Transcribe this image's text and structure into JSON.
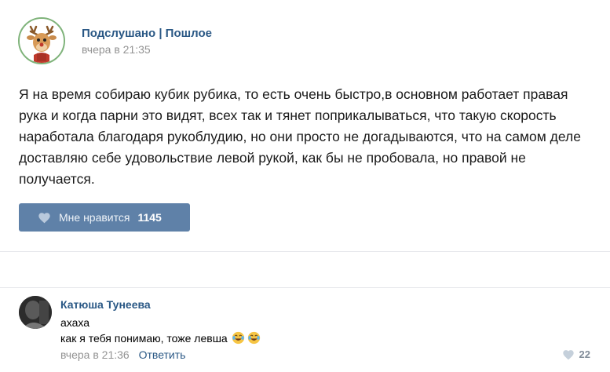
{
  "post": {
    "author": "Подслушано | Пошлое",
    "time": "вчера в 21:35",
    "text": "Я на время собираю кубик рубика, то есть очень быстро,в основном работает правая рука и когда парни это видят, всех так и тянет поприкалываться, что такую скорость наработала благодаря рукоблудию, но они просто не догадываются, что на самом деле доставляю себе удовольствие левой рукой, как бы не пробовала, но правой не получается.",
    "like_label": "Мне нравится",
    "like_count": "1145",
    "avatar_icon": "deer-mascot-icon"
  },
  "comment": {
    "author": "Катюша Тунеева",
    "line1": "ахаха",
    "line2": "как я тебя понимаю, тоже левша",
    "emoji": [
      "tears-of-joy-emoji",
      "tears-of-joy-emoji"
    ],
    "time": "вчера в 21:36",
    "reply_label": "Ответить",
    "like_count": "22"
  },
  "colors": {
    "link": "#2a5885",
    "like_button": "#5f81a8",
    "meta": "#939393"
  }
}
